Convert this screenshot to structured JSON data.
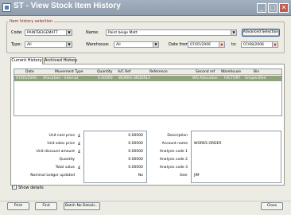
{
  "window": {
    "title": "ST - View Stock Item History",
    "minimize_glyph": "_",
    "maximize_glyph": "□",
    "close_glyph": "✕"
  },
  "selection": {
    "group_label": "Item history selection",
    "code_label": "Code:",
    "code_value": "PAINTBEIGEMATT",
    "name_label": "Name:",
    "name_value": "Paint beige Matt",
    "type_label": "Type:",
    "type_value": "All",
    "warehouse_label": "Warehouse:",
    "warehouse_value": "All",
    "date_from_label": "Date from:",
    "date_from_value": "07/05/2006",
    "to_label": "to:",
    "date_to_value": "07/08/2006",
    "advanced_button": "Advanced Selection"
  },
  "tabs": [
    {
      "label": "Current History",
      "active": true
    },
    {
      "label": "Archived History",
      "active": false
    }
  ],
  "table": {
    "columns": [
      "Date",
      "Movement Type",
      "Quantity",
      "A/C Ref",
      "Reference",
      "Second ref",
      "Warehouse",
      "Bin"
    ],
    "rows": [
      {
        "date": "07/05/2006",
        "movement_type": "Allocation - Internal",
        "quantity": "0.00000",
        "ac_ref": "WORKS ORDER",
        "reference": "13",
        "second_ref": "WO Allocation",
        "warehouse": "FACTORY",
        "bin": "Unspecified"
      }
    ]
  },
  "details": {
    "currency_symbol": "£",
    "unit_cost_price_label": "Unit cost price",
    "unit_cost_price": "0.00000",
    "unit_sales_price_label": "Unit sales price",
    "unit_sales_price": "0.00000",
    "unit_discount_label": "Unit discount amount",
    "unit_discount": "0.00000",
    "quantity_label": "Quantity",
    "quantity": "0.00000",
    "total_value_label": "Total value",
    "total_value": "0.00000",
    "nominal_ledger_label": "Nominal Ledger updated",
    "nominal_ledger_value": "No",
    "description_label": "Description",
    "description_value": "",
    "account_name_label": "Account name",
    "account_name_value": "WORKS ORDER",
    "analysis1_label": "Analysis code 1",
    "analysis1_value": "",
    "analysis2_label": "Analysis code 2",
    "analysis2_value": "",
    "analysis3_label": "Analysis code 3",
    "analysis3_value": "",
    "user_label": "User",
    "user_value": "JIM",
    "show_details_label": "Show details",
    "show_details_checked": true
  },
  "buttons": {
    "print": "Print",
    "find": "Find",
    "batch_no_details": "Batch No Details...",
    "close": "Close"
  },
  "colors": {
    "titlebar": "#9aa7b6",
    "selected_row": "#8ea37e",
    "group_label": "#8b1b1b",
    "window_bg": "#ecebe4"
  }
}
